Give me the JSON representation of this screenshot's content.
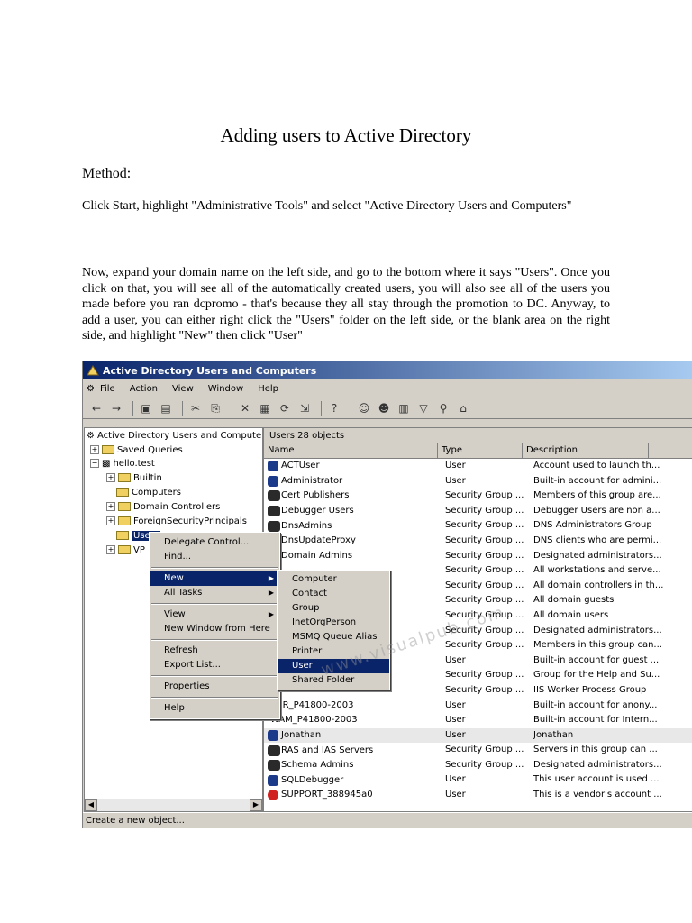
{
  "doc": {
    "title": "Adding users to Active Directory",
    "method": "Method:",
    "step1": "Click Start, highlight \"Administrative Tools\" and select \"Active Directory Users and Computers\"",
    "paragraph": "Now, expand your domain name on the left side, and go to the bottom where it says \"Users\". Once you click on that, you will see all of the automatically created users, you will also see all of the users you made before you ran dcpromo - that's because they all stay through the promotion to DC.  Anyway, to add a user, you can either right click the \"Users\" folder on the left side, or the blank area on the right side, and highlight \"New\" then click \"User\""
  },
  "window": {
    "title": "Active Directory Users and Computers",
    "menus": [
      "File",
      "Action",
      "View",
      "Window",
      "Help"
    ],
    "tree": {
      "root": "Active Directory Users and Computers",
      "saved_queries": "Saved Queries",
      "domain": "hello.test",
      "items": [
        "Builtin",
        "Computers",
        "Domain Controllers",
        "ForeignSecurityPrincipals",
        "Users",
        "VP"
      ]
    },
    "right_header": "Users   28 objects",
    "columns": [
      "Name",
      "Type",
      "Description"
    ],
    "rows": [
      {
        "name": "ACTUser",
        "type": "User",
        "desc": "Account used to launch th...",
        "icon": "user"
      },
      {
        "name": "Administrator",
        "type": "User",
        "desc": "Built-in account for admini...",
        "icon": "user"
      },
      {
        "name": "Cert Publishers",
        "type": "Security Group ...",
        "desc": "Members of this group are...",
        "icon": "group"
      },
      {
        "name": "Debugger Users",
        "type": "Security Group ...",
        "desc": "Debugger Users are non a...",
        "icon": "group"
      },
      {
        "name": "DnsAdmins",
        "type": "Security Group ...",
        "desc": "DNS Administrators Group",
        "icon": "group"
      },
      {
        "name": "DnsUpdateProxy",
        "type": "Security Group ...",
        "desc": "DNS clients who are permi...",
        "icon": "group"
      },
      {
        "name": "Domain Admins",
        "type": "Security Group ...",
        "desc": "Designated administrators...",
        "icon": "group"
      },
      {
        "name": "",
        "type": "Security Group ...",
        "desc": "All workstations and serve...",
        "icon": "none"
      },
      {
        "name": "",
        "type": "Security Group ...",
        "desc": "All domain controllers in th...",
        "icon": "none"
      },
      {
        "name": "",
        "type": "Security Group ...",
        "desc": "All domain guests",
        "icon": "none"
      },
      {
        "name": "",
        "type": "Security Group ...",
        "desc": "All domain users",
        "icon": "none"
      },
      {
        "name": "",
        "type": "Security Group ...",
        "desc": "Designated administrators...",
        "icon": "none"
      },
      {
        "name": "rs",
        "type": "Security Group ...",
        "desc": "Members in this group can...",
        "icon": "none"
      },
      {
        "name": "",
        "type": "User",
        "desc": "Built-in account for guest ...",
        "icon": "none"
      },
      {
        "name": "",
        "type": "Security Group ...",
        "desc": "Group for the Help and Su...",
        "icon": "none"
      },
      {
        "name": "",
        "type": "Security Group ...",
        "desc": "IIS Worker Process Group",
        "icon": "none"
      },
      {
        "name": "IUSR_P41800-2003",
        "type": "User",
        "desc": "Built-in account for anony...",
        "icon": "none"
      },
      {
        "name": "IWAM_P41800-2003",
        "type": "User",
        "desc": "Built-in account for Intern...",
        "icon": "none"
      },
      {
        "name": "Jonathan",
        "type": "User",
        "desc": "Jonathan",
        "icon": "user"
      },
      {
        "name": "RAS and IAS Servers",
        "type": "Security Group ...",
        "desc": "Servers in this group can ...",
        "icon": "group"
      },
      {
        "name": "Schema Admins",
        "type": "Security Group ...",
        "desc": "Designated administrators...",
        "icon": "group"
      },
      {
        "name": "SQLDebugger",
        "type": "User",
        "desc": "This user account is used ...",
        "icon": "user"
      },
      {
        "name": "SUPPORT_388945a0",
        "type": "User",
        "desc": "This is a vendor's account ...",
        "icon": "disabled"
      }
    ],
    "context_menu": [
      "Delegate Control...",
      "Find...",
      "New",
      "All Tasks",
      "View",
      "New Window from Here",
      "Refresh",
      "Export List...",
      "Properties",
      "Help"
    ],
    "submenu": [
      "Computer",
      "Contact",
      "Group",
      "InetOrgPerson",
      "MSMQ Queue Alias",
      "Printer",
      "User",
      "Shared Folder"
    ],
    "status": "Create a new object..."
  },
  "watermark": "www.visualpub.com"
}
